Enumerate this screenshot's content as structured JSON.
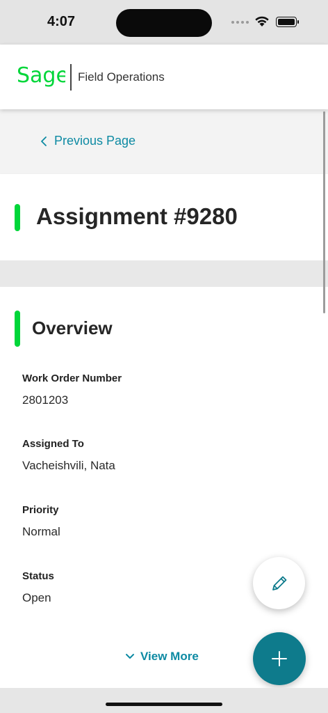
{
  "status_bar": {
    "time": "4:07",
    "battery_level": 1.0
  },
  "header": {
    "logo_text": "Sage",
    "app_name": "Field Operations",
    "brand_color": "#00d639"
  },
  "nav": {
    "back_label": "Previous Page",
    "link_color": "#0d8aa3"
  },
  "page": {
    "title": "Assignment #9280"
  },
  "overview": {
    "title": "Overview",
    "fields": [
      {
        "label": "Work Order Number",
        "value": "2801203"
      },
      {
        "label": "Assigned To",
        "value": "Vacheishvili, Nata"
      },
      {
        "label": "Priority",
        "value": "Normal"
      },
      {
        "label": "Status",
        "value": "Open"
      }
    ],
    "view_more_label": "View More"
  },
  "actions": {
    "edit_icon": "pencil-icon",
    "add_icon": "plus-icon",
    "fab_color": "#0e7b8c"
  }
}
